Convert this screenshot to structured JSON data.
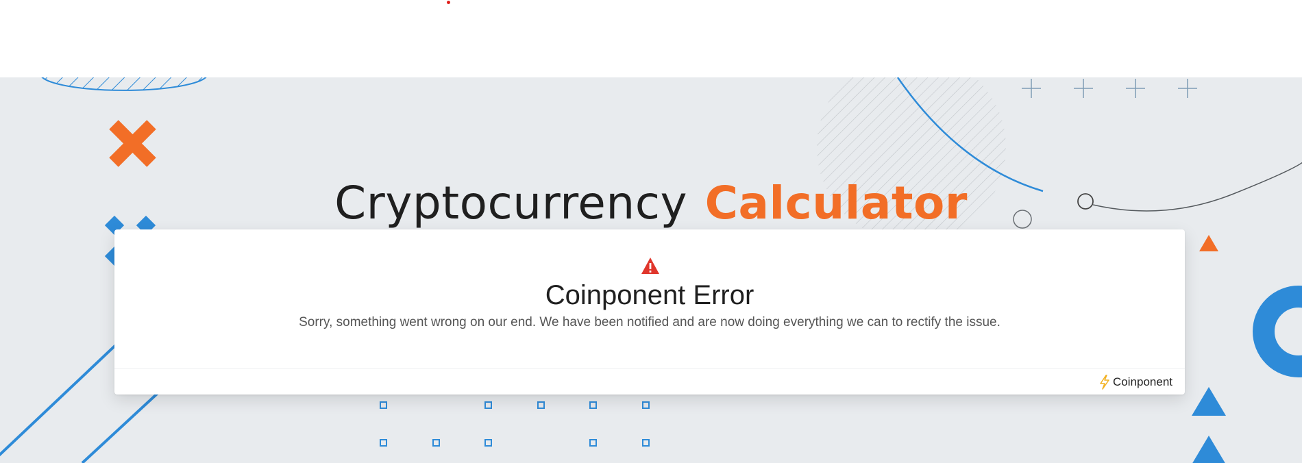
{
  "page": {
    "title_main": "Cryptocurrency",
    "title_accent": "Calculator"
  },
  "error_card": {
    "icon": "warning-icon",
    "title": "Coinponent Error",
    "message": "Sorry, something went wrong on our end. We have been notified and are now doing everything we can to rectify the issue.",
    "brand_icon": "lightning-icon",
    "brand_label": "Coinponent"
  },
  "colors": {
    "accent_orange": "#f26e27",
    "accent_blue": "#2e8bd8",
    "error_red": "#e0362c",
    "background": "#e8ebee"
  }
}
